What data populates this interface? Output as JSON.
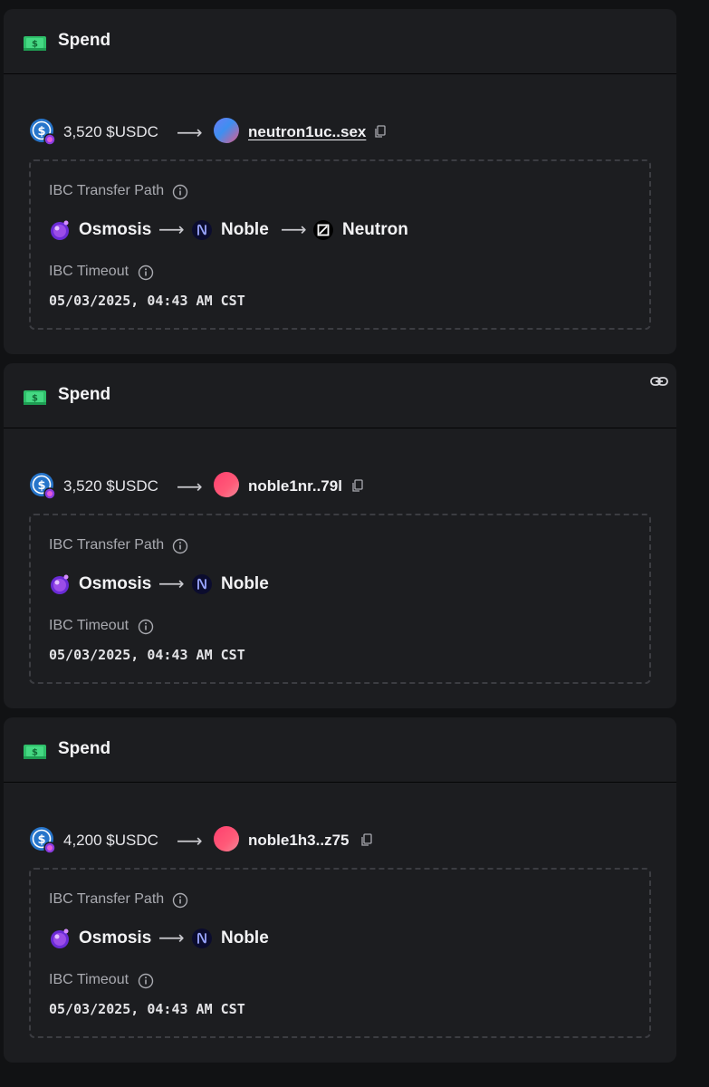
{
  "colors": {
    "page_bg": "#111214",
    "card_bg": "#1c1d20",
    "text": "#e9e9ec",
    "muted": "#a9aab0",
    "dashed_border": "#3c3d42"
  },
  "cards": [
    {
      "title": "Spend",
      "amount": "3,520 $USDC",
      "recipient": "neutron1uc..sex",
      "recipient_avatar": "blue-gradient",
      "recipient_underlined": true,
      "path_label": "IBC Transfer Path",
      "path": [
        "Osmosis",
        "Noble",
        "Neutron"
      ],
      "timeout_label": "IBC Timeout",
      "timeout_value": "05/03/2025, 04:43 AM CST",
      "has_link_icon": false
    },
    {
      "title": "Spend",
      "amount": "3,520 $USDC",
      "recipient": "noble1nr..79l",
      "recipient_avatar": "red-gradient",
      "recipient_underlined": false,
      "path_label": "IBC Transfer Path",
      "path": [
        "Osmosis",
        "Noble"
      ],
      "timeout_label": "IBC Timeout",
      "timeout_value": "05/03/2025, 04:43 AM CST",
      "has_link_icon": true
    },
    {
      "title": "Spend",
      "amount": "4,200 $USDC",
      "recipient": "noble1h3..z75",
      "recipient_avatar": "red-gradient",
      "recipient_underlined": false,
      "path_label": "IBC Transfer Path",
      "path": [
        "Osmosis",
        "Noble"
      ],
      "timeout_label": "IBC Timeout",
      "timeout_value": "05/03/2025, 04:43 AM CST",
      "has_link_icon": false
    }
  ],
  "icons": {
    "spend": "money-stack-icon",
    "token": "usdc-token-icon",
    "copy": "copy-icon",
    "info": "info-icon",
    "link": "link-icon",
    "osmosis": "osmosis-chain-icon",
    "noble": "noble-chain-icon",
    "neutron": "neutron-chain-icon"
  }
}
